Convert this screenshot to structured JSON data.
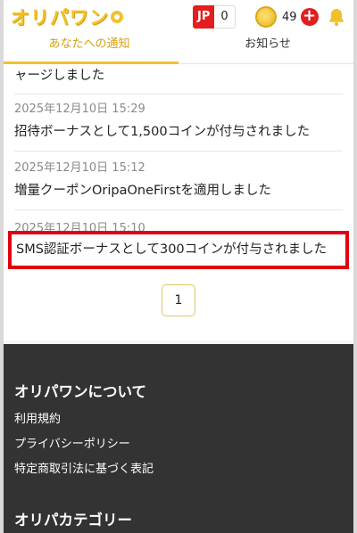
{
  "header": {
    "logo": "オリパワン",
    "jp_label": "JP",
    "jp_value": "0",
    "coin_value": "49",
    "plus_label": "+"
  },
  "tabs": [
    {
      "label": "あなたへの通知",
      "active": true
    },
    {
      "label": "お知らせ",
      "active": false
    }
  ],
  "notifications": [
    {
      "date": "",
      "message": "ャージしました"
    },
    {
      "date": "2025年12月10日 15:29",
      "message": "招待ボーナスとして1,500コインが付与されました"
    },
    {
      "date": "2025年12月10日 15:12",
      "message": "増量クーポンOripaOneFirstを適用しました"
    },
    {
      "date": "2025年12月10日 15:10",
      "message": "SMS認証ボーナスとして300コインが付与されました"
    }
  ],
  "pagination": {
    "current": "1"
  },
  "footer": {
    "about_title": "オリパワンについて",
    "links": [
      "利用規約",
      "プライバシーポリシー",
      "特定商取引法に基づく表記"
    ],
    "category_title": "オリパカテゴリー"
  },
  "colors": {
    "brand_yellow": "#f1c12b",
    "jp_red": "#e21e1e",
    "highlight_red": "#e00010",
    "footer_bg": "#333333"
  }
}
